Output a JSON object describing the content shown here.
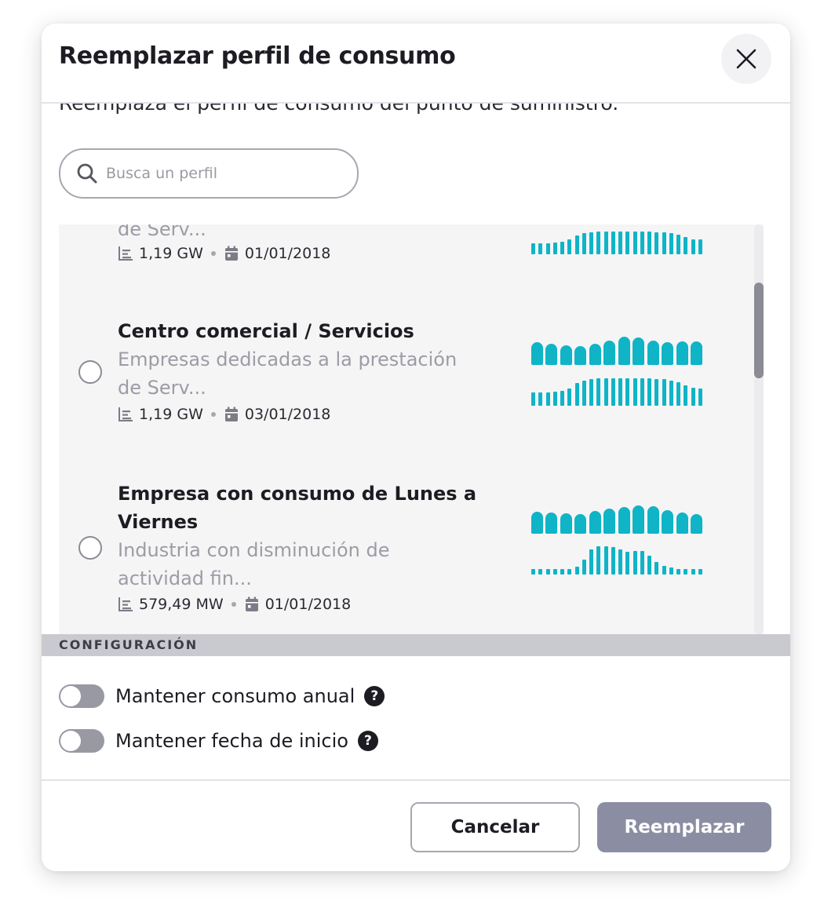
{
  "dialog": {
    "title": "Reemplazar perfil de consumo",
    "subtitle": "Reemplaza el perfil de consumo del punto de suministro."
  },
  "search": {
    "placeholder": "Busca un perfil",
    "value": ""
  },
  "profiles": [
    {
      "title": "",
      "desc_line2": "de Serv...",
      "energy": "1,19 GW",
      "date": "01/01/2018"
    },
    {
      "title": "Centro comercial / Servicios",
      "desc_line1": "Empresas dedicadas a la prestación",
      "desc_line2": "de Serv...",
      "energy": "1,19 GW",
      "date": "03/01/2018"
    },
    {
      "title_line1": "Empresa con consumo de Lunes a",
      "title_line2": "Viernes",
      "desc_line1": "Industria con disminución de",
      "desc_line2": "actividad fin...",
      "energy": "579,49 MW",
      "date": "01/01/2018"
    }
  ],
  "graphs": {
    "color": "#0fb4c6",
    "profile_1_hourly": [
      0.46,
      0.46,
      0.46,
      0.5,
      0.54,
      0.62,
      0.8,
      0.9,
      0.94,
      0.96,
      0.96,
      0.96,
      0.96,
      0.96,
      0.96,
      0.96,
      0.96,
      0.94,
      0.94,
      0.9,
      0.82,
      0.72,
      0.64,
      0.62
    ],
    "profile_2_monthly": [
      0.8,
      0.74,
      0.7,
      0.68,
      0.74,
      0.86,
      1.0,
      0.98,
      0.86,
      0.8,
      0.82,
      0.84
    ],
    "profile_2_hourly": [
      0.46,
      0.46,
      0.46,
      0.5,
      0.54,
      0.62,
      0.8,
      0.9,
      0.94,
      0.96,
      0.96,
      0.96,
      0.96,
      0.96,
      0.96,
      0.96,
      0.96,
      0.94,
      0.94,
      0.9,
      0.82,
      0.72,
      0.64,
      0.62
    ],
    "profile_3_monthly": [
      0.78,
      0.74,
      0.72,
      0.7,
      0.8,
      0.9,
      0.94,
      1.0,
      0.96,
      0.84,
      0.74,
      0.7
    ],
    "profile_3_hourly": [
      0.2,
      0.2,
      0.2,
      0.2,
      0.2,
      0.2,
      0.28,
      0.52,
      0.9,
      1.0,
      1.0,
      0.98,
      0.9,
      0.8,
      0.82,
      0.84,
      0.66,
      0.44,
      0.3,
      0.24,
      0.2,
      0.2,
      0.2,
      0.2
    ]
  },
  "settings": {
    "section_label": "CONFIGURACIÓN",
    "keep_annual_label": "Mantener consumo anual",
    "keep_start_label": "Mantener fecha de inicio",
    "keep_annual_on": false,
    "keep_start_on": false,
    "help_glyph": "?"
  },
  "footer": {
    "cancel_label": "Cancelar",
    "replace_label": "Reemplazar"
  }
}
